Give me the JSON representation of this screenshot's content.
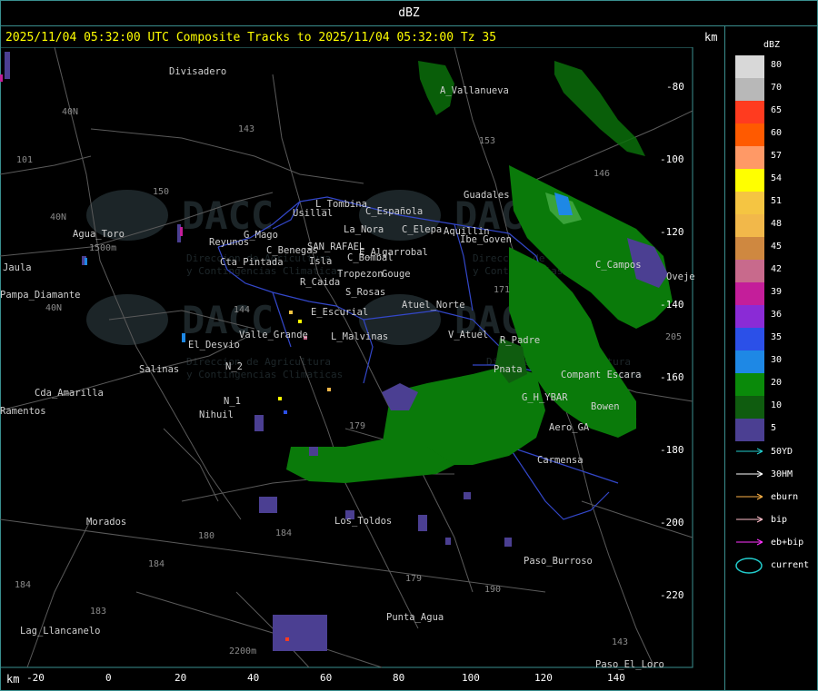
{
  "window_title": "dBZ",
  "header": {
    "text": "2025/11/04 05:32:00 UTC Composite Tracks to 2025/11/04 05:32:00 Tz 35",
    "km_top": "km",
    "km_bottom": "km"
  },
  "x_axis_ticks": [
    "-20",
    "0",
    "20",
    "40",
    "60",
    "80",
    "100",
    "120",
    "140"
  ],
  "y_axis_ticks": [
    "-80",
    "-100",
    "-120",
    "-140",
    "-160",
    "-180",
    "-200",
    "-220"
  ],
  "legend": {
    "title": "dBZ",
    "levels": [
      {
        "label": "80",
        "color": "#d8d8d8"
      },
      {
        "label": "70",
        "color": "#b8b8b8"
      },
      {
        "label": "65",
        "color": "#ff3b1f"
      },
      {
        "label": "60",
        "color": "#ff5a00"
      },
      {
        "label": "57",
        "color": "#ff9966"
      },
      {
        "label": "54",
        "color": "#ffff00"
      },
      {
        "label": "51",
        "color": "#f5c542"
      },
      {
        "label": "48",
        "color": "#f2b84a"
      },
      {
        "label": "45",
        "color": "#cf8840"
      },
      {
        "label": "42",
        "color": "#c86a8c"
      },
      {
        "label": "39",
        "color": "#c41e9a"
      },
      {
        "label": "36",
        "color": "#8a2bd6"
      },
      {
        "label": "35",
        "color": "#2b50e8"
      },
      {
        "label": "30",
        "color": "#1e88e5"
      },
      {
        "label": "20",
        "color": "#0a8a0a"
      },
      {
        "label": "10",
        "color": "#0f5c0f"
      },
      {
        "label": "5",
        "color": "#4b3f92"
      }
    ],
    "tracks": [
      {
        "label": "50YD",
        "color": "#22cccc"
      },
      {
        "label": "30HM",
        "color": "#ffffff"
      },
      {
        "label": "eburn",
        "color": "#ffb347"
      },
      {
        "label": "bip",
        "color": "#ffc0cb"
      },
      {
        "label": "eb+bip",
        "color": "#ff33ff"
      },
      {
        "label": "current",
        "color": "#22cccc"
      }
    ]
  },
  "places": [
    {
      "name": "Divisadero"
    },
    {
      "name": "A_Vallanueva"
    },
    {
      "name": "Guadales"
    },
    {
      "name": "L_Tombina"
    },
    {
      "name": "Usillal"
    },
    {
      "name": "C_Española"
    },
    {
      "name": "La_Nora"
    },
    {
      "name": "C_Elepa"
    },
    {
      "name": "Aquillin"
    },
    {
      "name": "Ibe_Goven"
    },
    {
      "name": "Agua_Toro"
    },
    {
      "name": "Reyunos"
    },
    {
      "name": "G_Mago"
    },
    {
      "name": "C_Benegas"
    },
    {
      "name": "SAN_RAFAEL"
    },
    {
      "name": "E_Algarrobal"
    },
    {
      "name": "C_Bombal"
    },
    {
      "name": "Cta_Pintada"
    },
    {
      "name": "Isla"
    },
    {
      "name": "Tropezon"
    },
    {
      "name": "Gouge"
    },
    {
      "name": "R_Caida"
    },
    {
      "name": "S_Rosas"
    },
    {
      "name": "C_Campos"
    },
    {
      "name": "Oveje"
    },
    {
      "name": "Jaula"
    },
    {
      "name": "Pampa_Diamante"
    },
    {
      "name": "Atuel_Norte"
    },
    {
      "name": "E_Escurial"
    },
    {
      "name": "Valle_Grande"
    },
    {
      "name": "L_Malvinas"
    },
    {
      "name": "V_Atuel"
    },
    {
      "name": "R_Padre"
    },
    {
      "name": "El_Desvio"
    },
    {
      "name": "Salinas"
    },
    {
      "name": "N_2"
    },
    {
      "name": "Pnata"
    },
    {
      "name": "Compant Escara"
    },
    {
      "name": "Cda_Amarilla"
    },
    {
      "name": "N_1"
    },
    {
      "name": "G_H_YBAR"
    },
    {
      "name": "Bowen"
    },
    {
      "name": "Nihuil"
    },
    {
      "name": "Aero_GA"
    },
    {
      "name": "Carmensa"
    },
    {
      "name": "Morados"
    },
    {
      "name": "Los_Toldos"
    },
    {
      "name": "Paso_Burroso"
    },
    {
      "name": "Punta_Agua"
    },
    {
      "name": "Lag_Llancanelo"
    },
    {
      "name": "Paso_El_Loro"
    },
    {
      "name": "Ramentos"
    }
  ],
  "route_labels": [
    "40N",
    "40N",
    "40N",
    "143",
    "150",
    "153",
    "146",
    "171",
    "144",
    "179",
    "180",
    "184",
    "184",
    "184",
    "183",
    "179",
    "190",
    "205",
    "143",
    "101",
    "1500m",
    "2200m"
  ],
  "watermark": {
    "logo": "DACC",
    "line1": "Direccion de Agricultura",
    "line2": "y Contingencias Climaticas"
  }
}
